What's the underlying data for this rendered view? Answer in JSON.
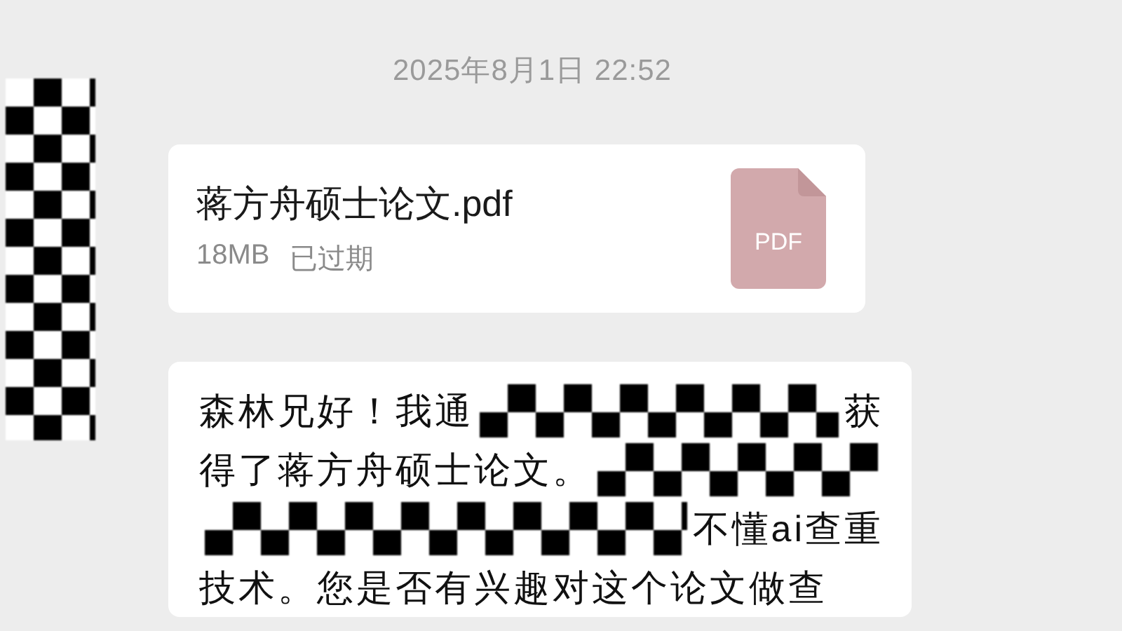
{
  "timestamp": "2025年8月1日 22:52",
  "file_message": {
    "name": "蒋方舟硕士论文.pdf",
    "size": "18MB",
    "status": "已过期",
    "type_label": "PDF",
    "expired": true
  },
  "text_message": {
    "lines": [
      [
        {
          "kind": "text",
          "text": "森林兄好！我通"
        },
        {
          "kind": "redaction"
        },
        {
          "kind": "text",
          "text": "获"
        }
      ],
      [
        {
          "kind": "text",
          "text": "得了蒋方舟硕士论文。"
        },
        {
          "kind": "redaction"
        }
      ],
      [
        {
          "kind": "redaction"
        },
        {
          "kind": "text",
          "text": "不懂ai查重"
        }
      ],
      [
        {
          "kind": "text",
          "text": "技术。您是否有兴趣对这个论文做查"
        }
      ]
    ]
  }
}
